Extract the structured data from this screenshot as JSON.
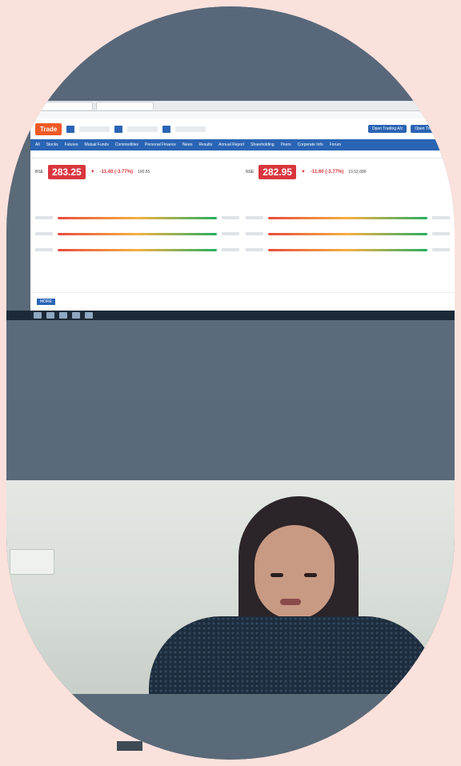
{
  "screen": {
    "brand": {
      "logo_text": "Trade",
      "cta_buttons": [
        "Open Trading A/c",
        "Open Trading A/c"
      ]
    },
    "nav": {
      "items": [
        "All",
        "Stocks",
        "Futures",
        "Mutual Funds",
        "Commodities",
        "Personal Finance",
        "News",
        "Results",
        "Annual Report",
        "Shareholding",
        "Peers",
        "Corporate Info",
        "Forum"
      ]
    },
    "quotes": [
      {
        "exchange": "BSE",
        "price": "283.25",
        "change": "-11.40 (-3.77%)",
        "volume": "190.55",
        "sell_red_fill_pct": 0.6,
        "buy_green_fill_pct": 0.4
      },
      {
        "exchange": "NSE",
        "price": "282.95",
        "change": "-11.60 (-3.77%)",
        "volume": "10,52,680",
        "sell_red_fill_pct": 0.6,
        "buy_green_fill_pct": 0.4
      }
    ],
    "footer": {
      "badge": "MORE"
    }
  },
  "colors": {
    "page_bg": "#fbe1dc",
    "brand_blue": "#2a64b4",
    "brand_orange": "#f05a24",
    "down_red": "#d9363e"
  }
}
